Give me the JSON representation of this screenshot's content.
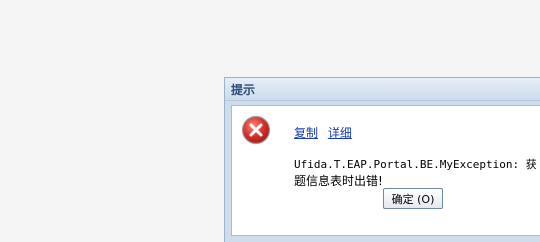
{
  "dialog": {
    "title": "提示",
    "links": {
      "copy": "复制",
      "details": "详细"
    },
    "message_line1": "Ufida.T.EAP.Portal.BE.MyException: 获",
    "message_line2": "题信息表时出错!",
    "ok_button": "确定 (O)",
    "icon": "error-icon"
  },
  "colors": {
    "title_text": "#2c4a74",
    "link": "#1a3fb5",
    "error_red": "#d9302b"
  }
}
